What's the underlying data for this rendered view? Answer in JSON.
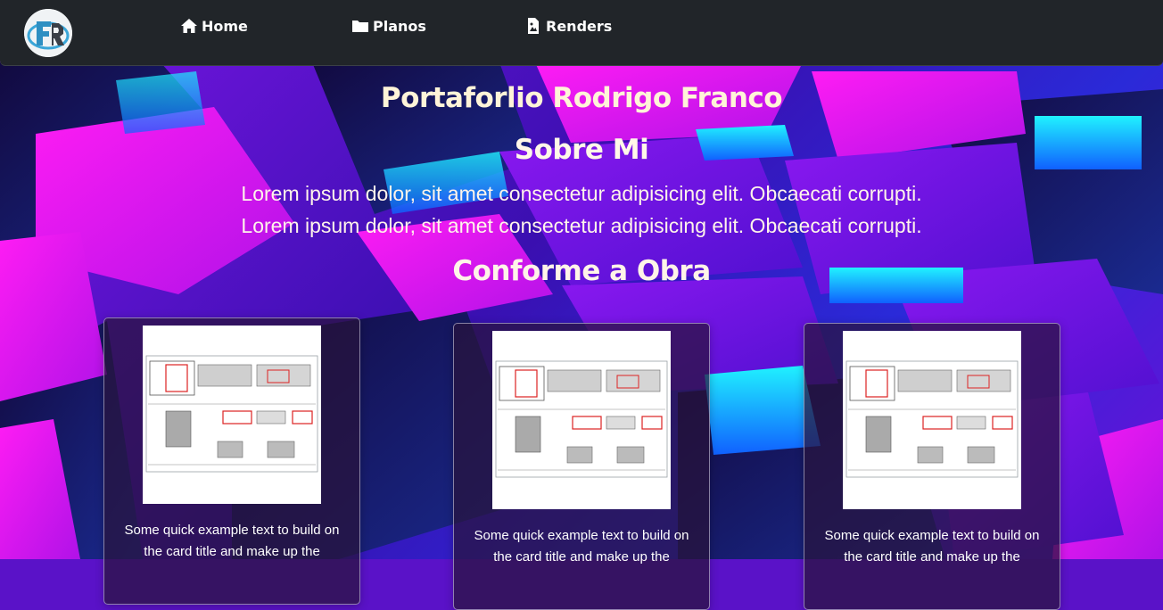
{
  "navbar": {
    "logo_icon": "fr-logo",
    "items": [
      {
        "label": "Home",
        "icon": "home-icon"
      },
      {
        "label": "Planos",
        "icon": "folder-icon"
      },
      {
        "label": "Renders",
        "icon": "file-image-icon"
      }
    ]
  },
  "main": {
    "title": "Portaforlio Rodrigo Franco",
    "about_title": "Sobre Mi",
    "about_lines": [
      "Lorem ipsum dolor, sit amet consectetur adipisicing elit. Obcaecati corrupti.",
      "Lorem ipsum dolor, sit amet consectetur adipisicing elit. Obcaecati corrupti."
    ],
    "works_title": "Conforme a Obra"
  },
  "cards": [
    {
      "text": "Some quick example text to build on the card title and make up the"
    },
    {
      "text": "Some quick example text to build on the card title and make up the"
    },
    {
      "text": "Some quick example text to build on the card title and make up the"
    }
  ],
  "colors": {
    "navbar": "#212529",
    "heading": "#fff4d8",
    "background_magenta": "#ff10f0",
    "background_cyan": "#10e8ff",
    "background_violet": "#6a10d8"
  }
}
